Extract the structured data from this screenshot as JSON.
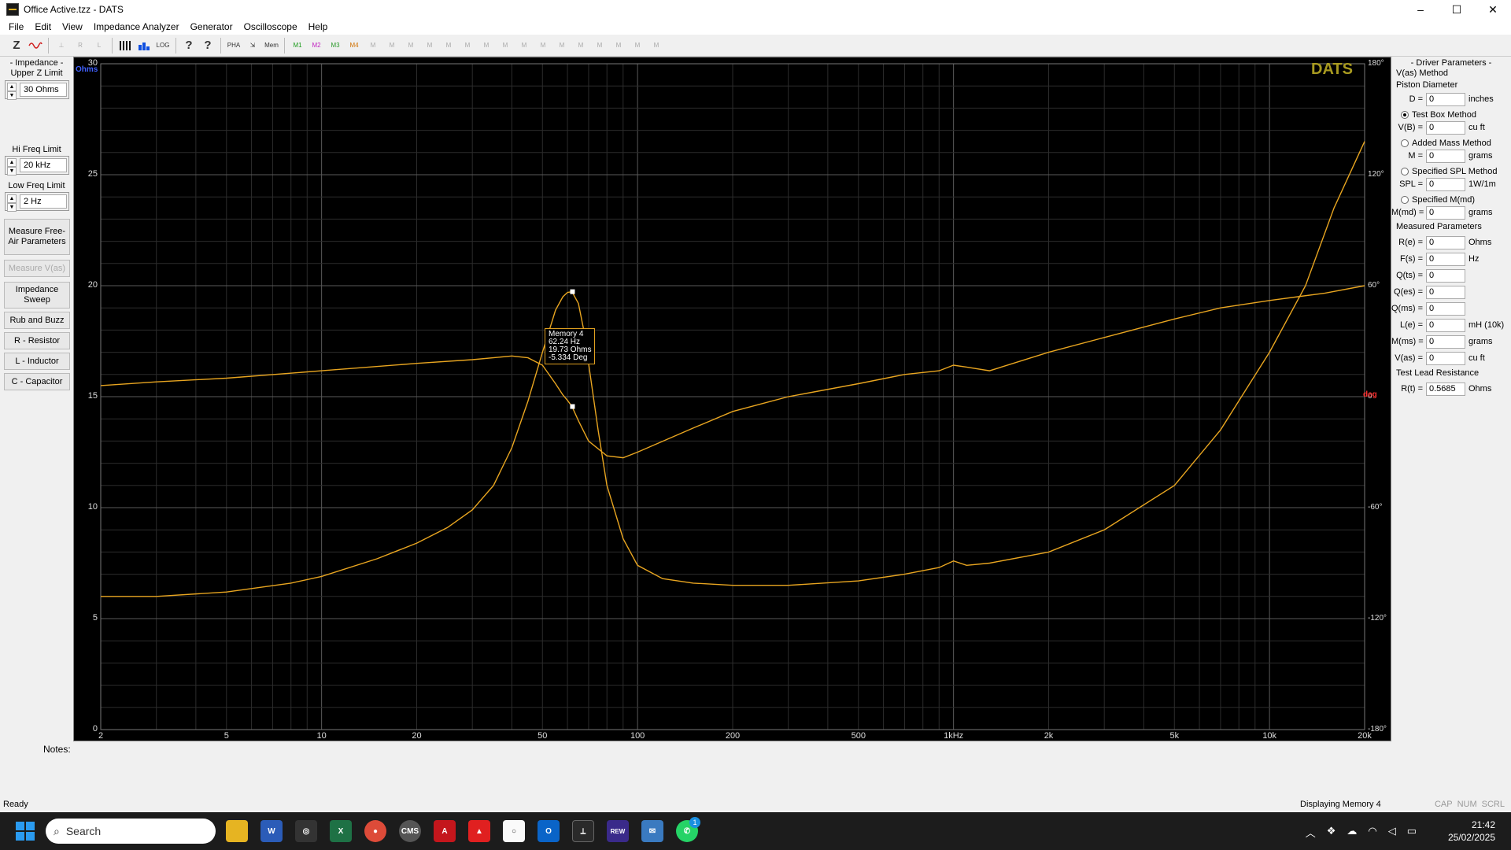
{
  "window": {
    "title": "Office Active.tzz - DATS",
    "minimize": "–",
    "maximize": "☐",
    "close": "✕"
  },
  "menu": [
    "File",
    "Edit",
    "View",
    "Impedance Analyzer",
    "Generator",
    "Oscilloscope",
    "Help"
  ],
  "toolbar": {
    "z_label": "Z",
    "tooltip_label": "?",
    "pha_label": "PHA",
    "mem_label": "Mem"
  },
  "left": {
    "impedance_title": "- Impedance -",
    "upper_z_title": "Upper Z Limit",
    "upper_z_value": "30 Ohms",
    "hi_freq_title": "Hi Freq Limit",
    "hi_freq_value": "20 kHz",
    "low_freq_title": "Low Freq Limit",
    "low_freq_value": "2 Hz",
    "buttons": {
      "measure_free_air": "Measure Free-Air Parameters",
      "measure_vas": "Measure V(as)",
      "impedance_sweep": "Impedance Sweep",
      "rub_buzz": "Rub and Buzz",
      "resistor": "R - Resistor",
      "inductor": "L - Inductor",
      "capacitor": "C - Capacitor"
    }
  },
  "plot": {
    "brand": "DATS",
    "left_unit": "Ohms",
    "right_unit": "deg",
    "tooltip": {
      "line1": "Memory 4",
      "line2": "62.24 Hz",
      "line3": "19.73 Ohms",
      "line4": "-5.334 Deg"
    },
    "x_ticks": [
      "2",
      "5",
      "10",
      "20",
      "50",
      "100",
      "200",
      "500",
      "1kHz",
      "2k",
      "5k",
      "10k",
      "20k"
    ],
    "y_ticks": [
      "30",
      "25",
      "20",
      "15",
      "10",
      "5",
      "0"
    ],
    "phase_ticks": [
      "180°",
      "120°",
      "60°",
      "0",
      "-60°",
      "-120°",
      "-180°"
    ]
  },
  "chart_data": {
    "type": "line",
    "xscale": "log",
    "xlim": [
      2,
      20000
    ],
    "ylim": [
      0,
      30
    ],
    "y2lim": [
      -180,
      180
    ],
    "xlabel": "",
    "ylabel": "Ohms",
    "y2label": "deg",
    "grid": true,
    "series": [
      {
        "axis": "left",
        "x": [
          2,
          3,
          5,
          8,
          10,
          15,
          20,
          25,
          30,
          35,
          40,
          45,
          50,
          55,
          58,
          60,
          62,
          65,
          68,
          70,
          75,
          80,
          90,
          100,
          120,
          150,
          200,
          300,
          500,
          700,
          900,
          1000,
          1100,
          1300,
          2000,
          3000,
          5000,
          7000,
          10000,
          13000,
          16000,
          20000
        ],
        "y": [
          6.0,
          6.0,
          6.2,
          6.6,
          6.9,
          7.7,
          8.4,
          9.1,
          9.9,
          11.0,
          12.7,
          14.8,
          17.0,
          18.9,
          19.5,
          19.7,
          19.73,
          19.2,
          17.8,
          16.5,
          13.5,
          11.0,
          8.6,
          7.4,
          6.8,
          6.6,
          6.5,
          6.5,
          6.7,
          7.0,
          7.3,
          7.6,
          7.4,
          7.5,
          8.0,
          9.0,
          11.0,
          13.5,
          17.0,
          20.0,
          23.5,
          26.5
        ]
      },
      {
        "axis": "right",
        "x": [
          2,
          3,
          5,
          10,
          20,
          30,
          40,
          45,
          50,
          55,
          58,
          60,
          62,
          65,
          70,
          80,
          90,
          100,
          150,
          200,
          300,
          500,
          700,
          900,
          1000,
          1100,
          1300,
          2000,
          3000,
          5000,
          7000,
          10000,
          15000,
          20000
        ],
        "y": [
          6,
          8,
          10,
          14,
          18,
          20,
          22,
          21,
          17,
          7,
          1,
          -2,
          -5.3,
          -13,
          -24,
          -32,
          -33,
          -30,
          -17,
          -8,
          0,
          7,
          12,
          14,
          17,
          16,
          14,
          24,
          32,
          42,
          48,
          52,
          56,
          60
        ]
      }
    ],
    "markers": [
      {
        "x": 62.24,
        "y": 19.73,
        "axis": "left"
      },
      {
        "x": 62.24,
        "y": -5.334,
        "axis": "right"
      }
    ]
  },
  "right": {
    "driver_params_title": "- Driver Parameters -",
    "vas_method_title": "V(as) Method",
    "piston_diameter": "Piston Diameter",
    "d": {
      "label": "D =",
      "value": "0",
      "unit": "inches"
    },
    "test_box": "Test Box Method",
    "vb": {
      "label": "V(B) =",
      "value": "0",
      "unit": "cu ft"
    },
    "added_mass": "Added Mass Method",
    "m": {
      "label": "M =",
      "value": "0",
      "unit": "grams"
    },
    "specified_spl": "Specified SPL Method",
    "spl": {
      "label": "SPL =",
      "value": "0",
      "unit": "1W/1m"
    },
    "specified_mmd": "Specified M(md)",
    "mmd": {
      "label": "M(md) =",
      "value": "0",
      "unit": "grams"
    },
    "measured_title": "Measured Parameters",
    "re": {
      "label": "R(e) =",
      "value": "0",
      "unit": "Ohms"
    },
    "fs": {
      "label": "F(s) =",
      "value": "0",
      "unit": "Hz"
    },
    "qts": {
      "label": "Q(ts) =",
      "value": "0",
      "unit": ""
    },
    "qes": {
      "label": "Q(es) =",
      "value": "0",
      "unit": ""
    },
    "qms": {
      "label": "Q(ms) =",
      "value": "0",
      "unit": ""
    },
    "le": {
      "label": "L(e) =",
      "value": "0",
      "unit": "mH (10k)"
    },
    "mms": {
      "label": "M(ms) =",
      "value": "0",
      "unit": "grams"
    },
    "vas": {
      "label": "V(as) =",
      "value": "0",
      "unit": "cu ft"
    },
    "lead_title": "Test Lead Resistance",
    "rt": {
      "label": "R(t) =",
      "value": "0.5685",
      "unit": "Ohms"
    }
  },
  "notes_label": "Notes:",
  "status": {
    "left": "Ready",
    "right": "Displaying Memory 4",
    "cap": "CAP",
    "num": "NUM",
    "scrl": "SCRL"
  },
  "taskbar": {
    "search": "Search",
    "time": "21:42",
    "date": "25/02/2025",
    "badge": "1",
    "rew": "REW",
    "cms": "CMS"
  },
  "colors": {
    "trace": "#e8a520",
    "grid_major": "#5a5a5a",
    "grid_minor": "#2c2c2c",
    "brand": "#a89a20"
  }
}
